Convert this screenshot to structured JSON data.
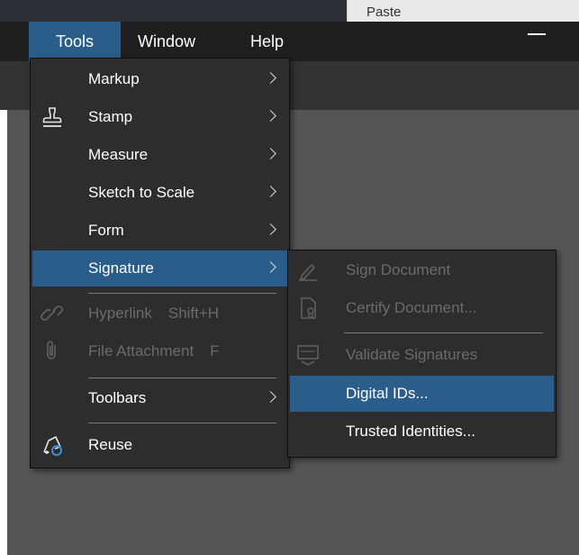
{
  "ribbon": {
    "paste_label": "Paste"
  },
  "menubar": {
    "items": [
      "Tools",
      "Window",
      "Help"
    ]
  },
  "tools_menu": {
    "items": [
      {
        "label": "Markup",
        "icon": "none",
        "submenu": true,
        "enabled": true
      },
      {
        "label": "Stamp",
        "icon": "stamp-icon",
        "submenu": true,
        "enabled": true
      },
      {
        "label": "Measure",
        "icon": "none",
        "submenu": true,
        "enabled": true
      },
      {
        "label": "Sketch to Scale",
        "icon": "none",
        "submenu": true,
        "enabled": true
      },
      {
        "label": "Form",
        "icon": "none",
        "submenu": true,
        "enabled": true
      },
      {
        "label": "Signature",
        "icon": "none",
        "submenu": true,
        "enabled": true,
        "highlighted": true
      },
      {
        "label": "Hyperlink",
        "shortcut": "Shift+H",
        "icon": "link-icon",
        "enabled": false
      },
      {
        "label": "File Attachment",
        "shortcut": "F",
        "icon": "paperclip-icon",
        "enabled": false
      },
      {
        "label": "Toolbars",
        "icon": "none",
        "submenu": true,
        "enabled": true
      },
      {
        "label": "Reuse",
        "icon": "reuse-icon",
        "enabled": true
      }
    ]
  },
  "signature_submenu": {
    "items": [
      {
        "label": "Sign Document",
        "icon": "pen-sign-icon",
        "enabled": false
      },
      {
        "label": "Certify Document...",
        "icon": "certify-icon",
        "enabled": false
      },
      {
        "label": "Validate Signatures",
        "icon": "validate-icon",
        "enabled": false
      },
      {
        "label": "Digital IDs...",
        "icon": "none",
        "enabled": true,
        "highlighted": true
      },
      {
        "label": "Trusted Identities...",
        "icon": "none",
        "enabled": true
      }
    ]
  },
  "colors": {
    "highlight": "#2b5d8a",
    "menu_bg": "#2d2d2d",
    "menubar_bg": "#1f1f1f",
    "disabled_text": "#6b6b6b"
  }
}
